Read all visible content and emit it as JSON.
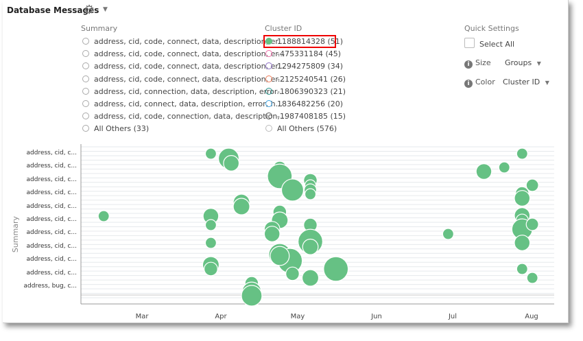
{
  "header": {
    "title": "Database Messages",
    "gear_icon": "gear-icon",
    "menu_icon": "caret-down-icon"
  },
  "summary_legend": {
    "title": "Summary",
    "items": [
      "address, cid, code, connect, data, description, er...",
      "address, cid, code, connect, data, description, er...",
      "address, cid, code, connect, data, description, er...",
      "address, cid, code, connect, data, description, er...",
      "address, cid, connection, data, description, error...",
      "address, cid, connect, data, description, error, h...",
      "address, cid, code, connection, data, description,...",
      "All Others (33)"
    ]
  },
  "cluster_legend": {
    "title": "Cluster ID",
    "items": [
      {
        "label": "1188814328 (51)",
        "color": "#66c184",
        "selected": true
      },
      {
        "label": "-475331184 (45)",
        "color": "#f06aa8",
        "selected": false
      },
      {
        "label": "1294275809 (34)",
        "color": "#8a6cc4",
        "selected": false
      },
      {
        "label": "-2125240541 (26)",
        "color": "#ef7a55",
        "selected": false
      },
      {
        "label": "-1806390323 (21)",
        "color": "#1f8f86",
        "selected": false
      },
      {
        "label": "1836482256 (20)",
        "color": "#3aa0e0",
        "selected": false
      },
      {
        "label": "-1987408185 (15)",
        "color": "#555555",
        "selected": false
      },
      {
        "label": "All Others (576)",
        "color": "#bbbbbb",
        "selected": false
      }
    ]
  },
  "quick_settings": {
    "title": "Quick Settings",
    "select_all": "Select All",
    "size_label": "Size",
    "size_value": "Groups",
    "color_label": "Color",
    "color_value": "Cluster ID"
  },
  "chart_data": {
    "type": "scatter",
    "ylabel": "Summary",
    "y_tick_labels": [
      "address, cid, c...",
      "address, cid, c...",
      "address, cid, c...",
      "address, cid, c...",
      "address, cid, c...",
      "address, cid, c...",
      "address, cid, c...",
      "address, cid, c...",
      "address, cid, c...",
      "address, cid, c...",
      "address, bug, c..."
    ],
    "x_tick_labels": [
      "Mar",
      "Apr",
      "May",
      "Jun",
      "Jul",
      "Aug"
    ],
    "xlim": [
      "02-10",
      "08-09"
    ],
    "bubble_color": "#66c184",
    "size_by": "Groups",
    "points": [
      {
        "date": "03-28",
        "row": 0,
        "size": 1
      },
      {
        "date": "04-04",
        "row": 0.36,
        "size": 3.5
      },
      {
        "date": "04-05",
        "row": 0.72,
        "size": 2
      },
      {
        "date": "04-24",
        "row": 1.08,
        "size": 1.5
      },
      {
        "date": "04-24",
        "row": 1.7,
        "size": 5
      },
      {
        "date": "04-29",
        "row": 2.73,
        "size": 4
      },
      {
        "date": "05-06",
        "row": 2.0,
        "size": 1.5
      },
      {
        "date": "05-06",
        "row": 2.37,
        "size": 1
      },
      {
        "date": "05-06",
        "row": 2.73,
        "size": 1.25
      },
      {
        "date": "05-06",
        "row": 3.04,
        "size": 1
      },
      {
        "date": "02-14",
        "row": 4.69,
        "size": 1
      },
      {
        "date": "03-28",
        "row": 4.69,
        "size": 2
      },
      {
        "date": "03-28",
        "row": 5.36,
        "size": 1
      },
      {
        "date": "04-09",
        "row": 3.66,
        "size": 2.25
      },
      {
        "date": "04-09",
        "row": 3.97,
        "size": 2.25
      },
      {
        "date": "04-24",
        "row": 4.38,
        "size": 1.5
      },
      {
        "date": "04-24",
        "row": 5.0,
        "size": 2.25
      },
      {
        "date": "04-21",
        "row": 5.67,
        "size": 2
      },
      {
        "date": "04-21",
        "row": 6.03,
        "size": 2
      },
      {
        "date": "05-06",
        "row": 5.36,
        "size": 1.5
      },
      {
        "date": "05-06",
        "row": 6.6,
        "size": 5
      },
      {
        "date": "05-06",
        "row": 7.0,
        "size": 2
      },
      {
        "date": "03-28",
        "row": 6.7,
        "size": 1
      },
      {
        "date": "04-24",
        "row": 7.58,
        "size": 4
      },
      {
        "date": "04-28",
        "row": 8.04,
        "size": 5
      },
      {
        "date": "04-24",
        "row": 7.68,
        "size": 3
      },
      {
        "date": "03-28",
        "row": 8.35,
        "size": 2.25
      },
      {
        "date": "03-28",
        "row": 8.66,
        "size": 1.5
      },
      {
        "date": "04-29",
        "row": 9.02,
        "size": 1.5
      },
      {
        "date": "05-06",
        "row": 9.33,
        "size": 2.25
      },
      {
        "date": "05-16",
        "row": 8.66,
        "size": 5
      },
      {
        "date": "04-13",
        "row": 9.74,
        "size": 1.5
      },
      {
        "date": "04-13",
        "row": 10.36,
        "size": 3
      },
      {
        "date": "04-13",
        "row": 10.67,
        "size": 3.5
      },
      {
        "date": "07-28",
        "row": 0,
        "size": 1
      },
      {
        "date": "07-13",
        "row": 1.34,
        "size": 2
      },
      {
        "date": "07-21",
        "row": 1.03,
        "size": 1
      },
      {
        "date": "08-01",
        "row": 2.37,
        "size": 1.25
      },
      {
        "date": "07-28",
        "row": 2.99,
        "size": 1.5
      },
      {
        "date": "07-28",
        "row": 3.35,
        "size": 2
      },
      {
        "date": "07-28",
        "row": 4.64,
        "size": 2
      },
      {
        "date": "07-28",
        "row": 5.0,
        "size": 1.25
      },
      {
        "date": "07-28",
        "row": 5.67,
        "size": 3.5
      },
      {
        "date": "08-01",
        "row": 5.31,
        "size": 1.25
      },
      {
        "date": "06-29",
        "row": 6.03,
        "size": 1
      },
      {
        "date": "07-28",
        "row": 6.7,
        "size": 2
      },
      {
        "date": "07-28",
        "row": 8.66,
        "size": 1
      },
      {
        "date": "08-01",
        "row": 9.33,
        "size": 1
      }
    ]
  }
}
